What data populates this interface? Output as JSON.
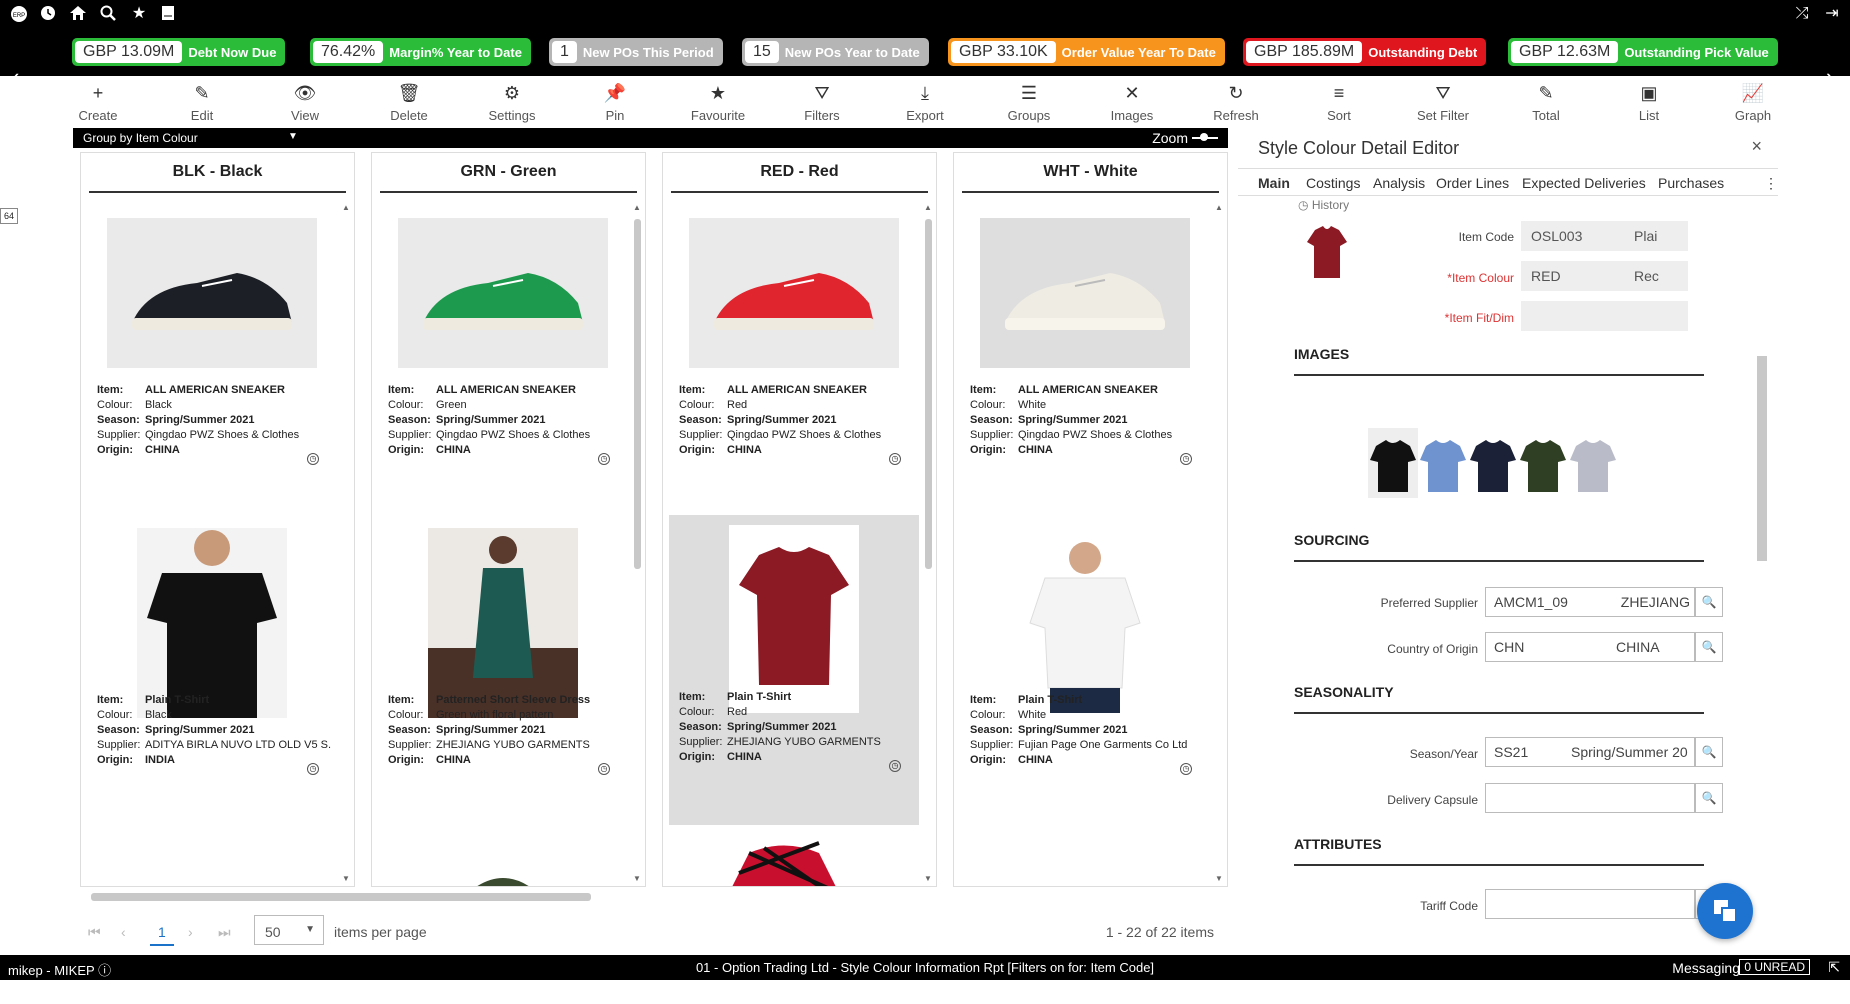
{
  "appbar": {
    "icons": [
      "erp-logo-icon",
      "clock-icon",
      "home-icon",
      "search-icon",
      "star-icon",
      "book-icon"
    ],
    "right_icons": [
      "shuffle-icon",
      "logout-icon"
    ]
  },
  "kpis": [
    {
      "value": "GBP 13.09M",
      "label": "Debt Now Due",
      "color": "#2bbd3a"
    },
    {
      "value": "76.42%",
      "label": "Margin% Year to Date",
      "color": "#2bbd3a"
    },
    {
      "value": "1",
      "label": "New POs This Period",
      "color": "#b5b5b5"
    },
    {
      "value": "15",
      "label": "New POs Year to Date",
      "color": "#b5b5b5"
    },
    {
      "value": "GBP 33.10K",
      "label": "Order Value Year To Date",
      "color": "#f7941d"
    },
    {
      "value": "GBP 185.89M",
      "label": "Outstanding Debt",
      "color": "#e0161e"
    },
    {
      "value": "GBP 12.63M",
      "label": "Outstanding Pick Value",
      "color": "#2bbd3a"
    }
  ],
  "toolbar": [
    {
      "label": "Create",
      "icon": "+"
    },
    {
      "label": "Edit",
      "icon": "✎"
    },
    {
      "label": "View",
      "icon": "👁"
    },
    {
      "label": "Delete",
      "icon": "🗑"
    },
    {
      "label": "Settings",
      "icon": "⚙"
    },
    {
      "label": "Pin",
      "icon": "📌"
    },
    {
      "label": "Favourite",
      "icon": "★"
    },
    {
      "label": "Filters",
      "icon": "⛛"
    },
    {
      "label": "Export",
      "icon": "⤓"
    },
    {
      "label": "Groups",
      "icon": "☰"
    },
    {
      "label": "Images",
      "icon": "✕"
    },
    {
      "label": "Refresh",
      "icon": "↻"
    },
    {
      "label": "Sort",
      "icon": "≡"
    },
    {
      "label": "Set Filter",
      "icon": "⛛"
    },
    {
      "label": "Total",
      "icon": "✎"
    },
    {
      "label": "List",
      "icon": "▣"
    },
    {
      "label": "Graph",
      "icon": "📈"
    }
  ],
  "groupbar": {
    "label": "Group by Item Colour",
    "zoom": "Zoom"
  },
  "labels": {
    "item": "Item:",
    "colour": "Colour:",
    "season": "Season:",
    "supplier": "Supplier:",
    "origin": "Origin:"
  },
  "columns": [
    {
      "title": "BLK - Black",
      "cards": [
        {
          "item": "ALL AMERICAN SNEAKER",
          "colour": "Black",
          "season": "Spring/Summer 2021",
          "supplier": "Qingdao PWZ Shoes & Clothes",
          "origin": "CHINA",
          "image": "black-sneaker"
        },
        {
          "item": "Plain T-Shirt",
          "colour": "Black",
          "season": "Spring/Summer 2021",
          "supplier": "ADITYA BIRLA NUVO LTD OLD V5 S...",
          "origin": "INDIA",
          "image": "black-tshirt"
        }
      ]
    },
    {
      "title": "GRN - Green",
      "cards": [
        {
          "item": "ALL AMERICAN SNEAKER",
          "colour": "Green",
          "season": "Spring/Summer 2021",
          "supplier": "Qingdao PWZ Shoes & Clothes",
          "origin": "CHINA",
          "image": "green-sneaker"
        },
        {
          "item": "Patterned Short Sleeve Dress",
          "colour": "Green with floral pattern",
          "season": "Spring/Summer 2021",
          "supplier": "ZHEJIANG YUBO GARMENTS",
          "origin": "CHINA",
          "image": "green-dress"
        }
      ]
    },
    {
      "title": "RED - Red",
      "cards": [
        {
          "item": "ALL AMERICAN SNEAKER",
          "colour": "Red",
          "season": "Spring/Summer 2021",
          "supplier": "Qingdao PWZ Shoes & Clothes",
          "origin": "CHINA",
          "image": "red-sneaker"
        },
        {
          "item": "Plain T-Shirt",
          "colour": "Red",
          "season": "Spring/Summer 2021",
          "supplier": "ZHEJIANG YUBO GARMENTS",
          "origin": "CHINA",
          "image": "red-tshirt"
        }
      ]
    },
    {
      "title": "WHT - White",
      "cards": [
        {
          "item": "ALL AMERICAN SNEAKER",
          "colour": "White",
          "season": "Spring/Summer 2021",
          "supplier": "Qingdao PWZ Shoes & Clothes",
          "origin": "CHINA",
          "image": "white-sneaker"
        },
        {
          "item": "Plain T-Shirt",
          "colour": "White",
          "season": "Spring/Summer 2021",
          "supplier": "Fujian Page One Garments Co Ltd",
          "origin": "CHINA",
          "image": "white-tshirt"
        }
      ]
    }
  ],
  "pager": {
    "page": "1",
    "per_page": "50",
    "per_page_label": "items per page",
    "summary": "1 - 22 of 22 items"
  },
  "panel": {
    "title": "Style Colour Detail Editor",
    "tabs": [
      "Main",
      "Costings",
      "Analysis",
      "Order Lines",
      "Expected Deliveries",
      "Purchases"
    ],
    "history": "History",
    "item_code_label": "Item Code",
    "item_code": "OSL003",
    "item_code_desc": "Plai",
    "item_colour_label": "*Item Colour",
    "item_colour": "RED",
    "item_colour_desc": "Rec",
    "item_fit_label": "*Item Fit/Dim",
    "images_title": "IMAGES",
    "sourcing_title": "SOURCING",
    "preferred_supplier_label": "Preferred Supplier",
    "preferred_supplier_code": "AMCM1_09",
    "preferred_supplier_name": "ZHEJIANG",
    "country_label": "Country of Origin",
    "country_code": "CHN",
    "country_name": "CHINA",
    "seasonality_title": "SEASONALITY",
    "season_label": "Season/Year",
    "season_code": "SS21",
    "season_name": "Spring/Summer 20",
    "capsule_label": "Delivery Capsule",
    "attributes_title": "ATTRIBUTES",
    "tariff_label": "Tariff Code"
  },
  "statusbar": {
    "user": "mikep - MIKEP",
    "center": "01 - Option Trading Ltd - Style Colour Information Rpt [Filters on for: Item Code]",
    "messaging": "Messaging",
    "unread": "0 UNREAD"
  },
  "side_badge": "64"
}
